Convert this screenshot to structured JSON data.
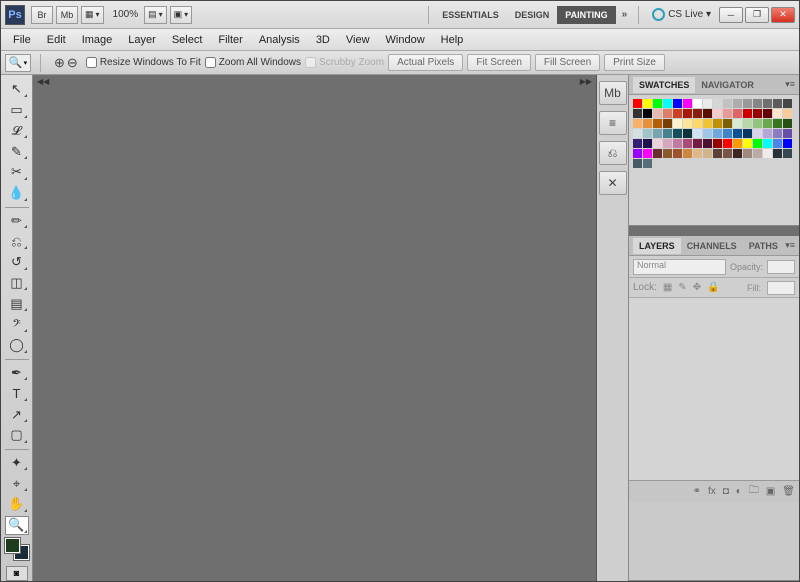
{
  "topbar": {
    "logo": "Ps",
    "shortcut_buttons": [
      "Br",
      "Mb"
    ],
    "zoom_value": "100%",
    "workspaces": [
      "ESSENTIALS",
      "DESIGN",
      "PAINTING"
    ],
    "active_workspace": 2,
    "cslive_label": "CS Live ▾"
  },
  "menubar": [
    "File",
    "Edit",
    "Image",
    "Layer",
    "Select",
    "Filter",
    "Analysis",
    "3D",
    "View",
    "Window",
    "Help"
  ],
  "options": {
    "checkbox1": "Resize Windows To Fit",
    "checkbox2": "Zoom All Windows",
    "checkbox3": "Scrubby Zoom",
    "buttons": [
      "Actual Pixels",
      "Fit Screen",
      "Fill Screen",
      "Print Size"
    ]
  },
  "tools": [
    {
      "name": "move-tool",
      "glyph": "↖"
    },
    {
      "name": "marquee-tool",
      "glyph": "▭"
    },
    {
      "name": "lasso-tool",
      "glyph": "𝓛"
    },
    {
      "name": "quick-select-tool",
      "glyph": "✎"
    },
    {
      "name": "crop-tool",
      "glyph": "✂"
    },
    {
      "name": "eyedropper-tool",
      "glyph": "💧"
    },
    {
      "name": "divider",
      "glyph": ""
    },
    {
      "name": "brush-tool",
      "glyph": "✏"
    },
    {
      "name": "clone-tool",
      "glyph": "⎌"
    },
    {
      "name": "history-brush-tool",
      "glyph": "↺"
    },
    {
      "name": "eraser-tool",
      "glyph": "◫"
    },
    {
      "name": "gradient-tool",
      "glyph": "▤"
    },
    {
      "name": "blur-tool",
      "glyph": "𝄢"
    },
    {
      "name": "dodge-tool",
      "glyph": "◯"
    },
    {
      "name": "divider",
      "glyph": ""
    },
    {
      "name": "pen-tool",
      "glyph": "✒"
    },
    {
      "name": "type-tool",
      "glyph": "T"
    },
    {
      "name": "path-tool",
      "glyph": "↗"
    },
    {
      "name": "shape-tool",
      "glyph": "▢"
    },
    {
      "name": "divider",
      "glyph": ""
    },
    {
      "name": "3d-tool",
      "glyph": "✦"
    },
    {
      "name": "3d-camera-tool",
      "glyph": "⌖"
    },
    {
      "name": "hand-tool",
      "glyph": "✋"
    },
    {
      "name": "zoom-tool",
      "glyph": "🔍",
      "active": true
    }
  ],
  "dock_icons": [
    {
      "name": "mini-bridge-icon",
      "glyph": "Mb"
    },
    {
      "name": "brushes-icon",
      "glyph": "≡"
    },
    {
      "name": "brush-presets-icon",
      "glyph": "⎌"
    },
    {
      "name": "tool-presets-icon",
      "glyph": "✕"
    }
  ],
  "swatches_panel": {
    "tabs": [
      "SWATCHES",
      "NAVIGATOR"
    ],
    "active": 0,
    "colors": [
      "#ff0000",
      "#ffff00",
      "#00ff00",
      "#00ffff",
      "#0000ff",
      "#ff00ff",
      "#ffffff",
      "#ebebeb",
      "#d6d6d6",
      "#c2c2c2",
      "#adadad",
      "#999999",
      "#858585",
      "#707070",
      "#5c5c5c",
      "#474747",
      "#333333",
      "#000000",
      "#e6b8af",
      "#dd7e6b",
      "#cc4125",
      "#a61c00",
      "#85200c",
      "#5b0f00",
      "#f4cccc",
      "#ea9999",
      "#e06666",
      "#cc0000",
      "#990000",
      "#660000",
      "#fce5cd",
      "#f9cb9c",
      "#f6b26b",
      "#e69138",
      "#b45f06",
      "#783f04",
      "#fff2cc",
      "#ffe599",
      "#ffd966",
      "#f1c232",
      "#bf9000",
      "#7f6000",
      "#d9ead3",
      "#b6d7a8",
      "#93c47d",
      "#6aa84f",
      "#38761d",
      "#274e13",
      "#d0e0e3",
      "#a2c4c9",
      "#76a5af",
      "#45818e",
      "#134f5c",
      "#0c343d",
      "#cfe2f3",
      "#9fc5e8",
      "#6fa8dc",
      "#3d85c6",
      "#0b5394",
      "#073763",
      "#d9d2e9",
      "#b4a7d6",
      "#8e7cc3",
      "#674ea7",
      "#351c75",
      "#20124d",
      "#ead1dc",
      "#d5a6bd",
      "#c27ba0",
      "#a64d79",
      "#741b47",
      "#4c1130",
      "#980000",
      "#ff0000",
      "#ff9900",
      "#ffff00",
      "#00ff00",
      "#00ffff",
      "#4a86e8",
      "#0000ff",
      "#9900ff",
      "#ff00ff",
      "#6b2e2e",
      "#8b5a2b",
      "#a0522d",
      "#cd853f",
      "#deb887",
      "#d2b48c",
      "#5d4037",
      "#795548",
      "#3e2723",
      "#a1887f",
      "#bcaaa4",
      "#efebe9",
      "#263238",
      "#37474f",
      "#455a64",
      "#546e7a"
    ]
  },
  "layers_panel": {
    "tabs": [
      "LAYERS",
      "CHANNELS",
      "PATHS"
    ],
    "active": 0,
    "blend_mode": "Normal",
    "opacity_label": "Opacity:",
    "lock_label": "Lock:",
    "fill_label": "Fill:"
  }
}
